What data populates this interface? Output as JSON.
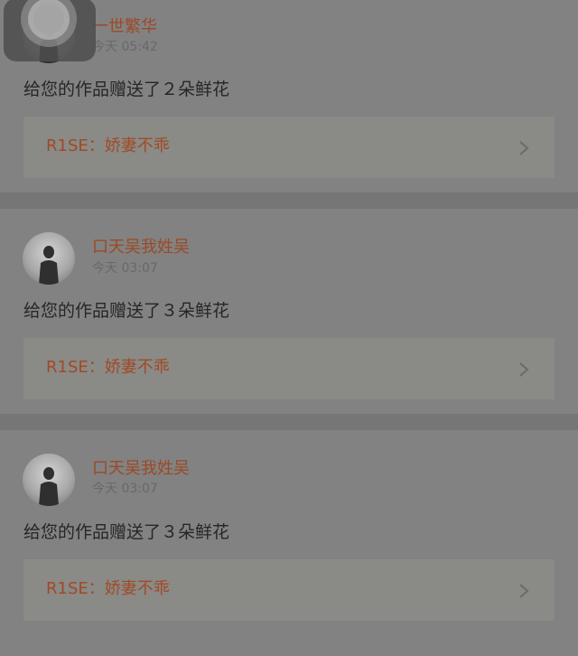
{
  "notifications": [
    {
      "username": "一世繁华",
      "time": "今天 05:42",
      "message": "给您的作品赠送了２朵鲜花",
      "work_title": "R1SE：娇妻不乖"
    },
    {
      "username": "口天吴我姓吴",
      "time": "今天 03:07",
      "message": "给您的作品赠送了３朵鲜花",
      "work_title": "R1SE：娇妻不乖"
    },
    {
      "username": "口天吴我姓吴",
      "time": "今天 03:07",
      "message": "给您的作品赠送了３朵鲜花",
      "work_title": "R1SE：娇妻不乖"
    }
  ],
  "icons": {
    "chevron": "chevron-right-icon",
    "assistive_touch": "assistive-touch-icon"
  },
  "colors": {
    "username": "#9b4a25",
    "work_title": "#a04a26",
    "message": "#262626",
    "time": "#686868"
  }
}
